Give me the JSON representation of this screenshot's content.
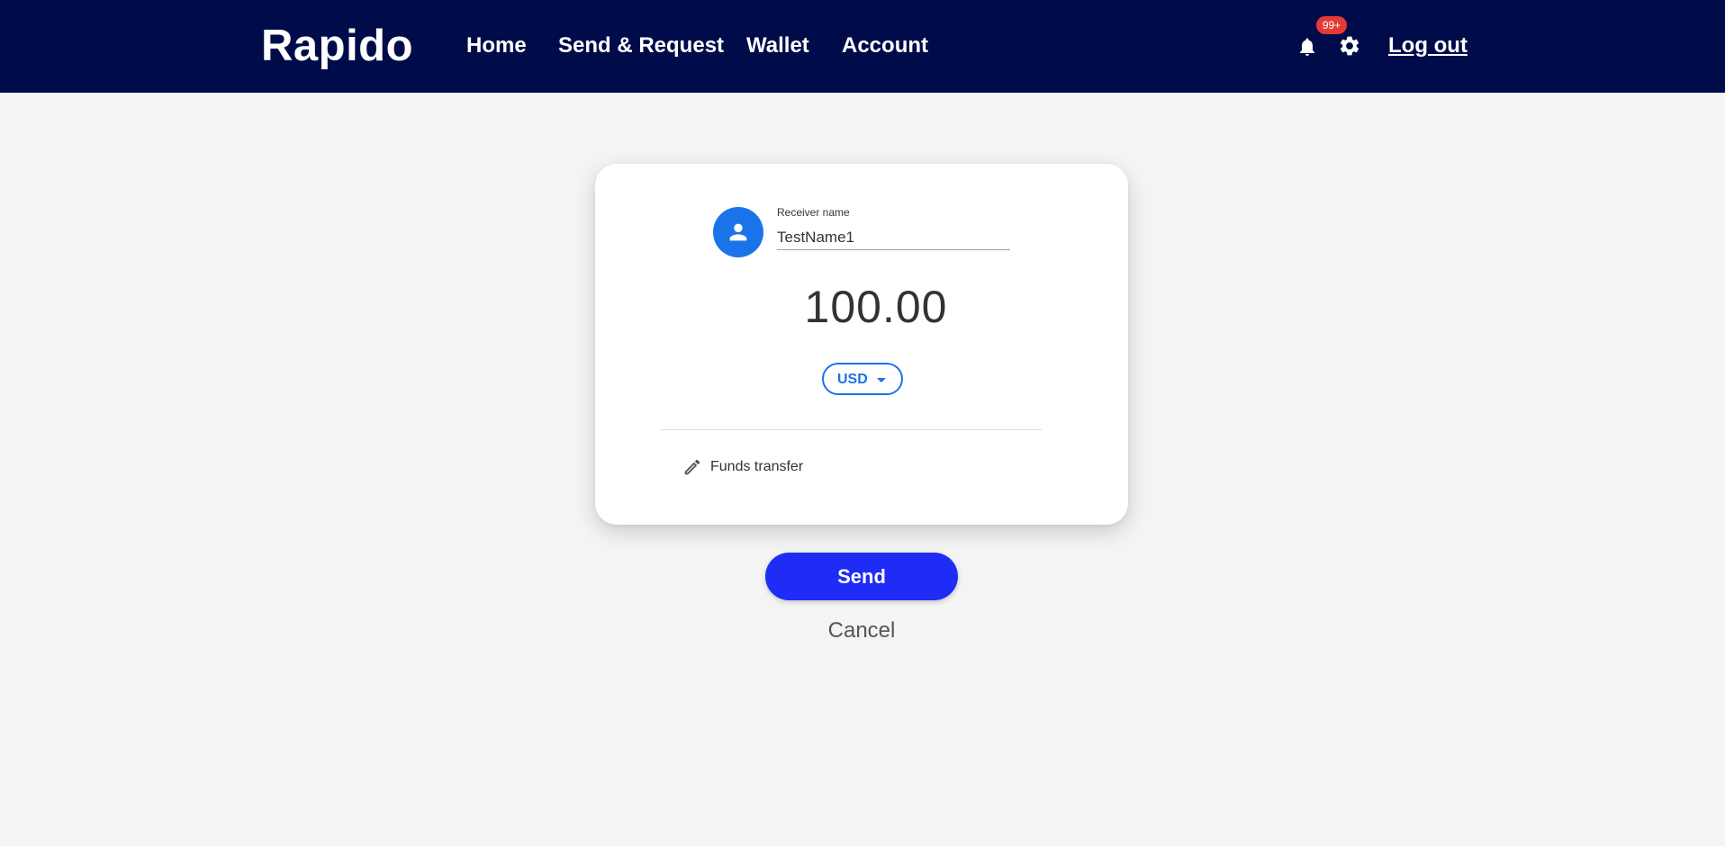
{
  "header": {
    "brand": "Rapido",
    "nav": [
      "Home",
      "Send & Request",
      "Wallet",
      "Account"
    ],
    "notifications_badge": "99+",
    "logout_label": "Log out",
    "background_color": "#000c49"
  },
  "transfer_form": {
    "receiver_label": "Receiver name",
    "receiver_value": "TestName1",
    "amount": "100.00",
    "currency": "USD",
    "note": "Funds transfer",
    "accent_color": "#1a73e8"
  },
  "actions": {
    "send_label": "Send",
    "cancel_label": "Cancel",
    "send_color": "#1e2cf5"
  },
  "icons": [
    "bell-icon",
    "gear-icon",
    "person-icon",
    "pencil-icon",
    "chevron-down-icon"
  ]
}
